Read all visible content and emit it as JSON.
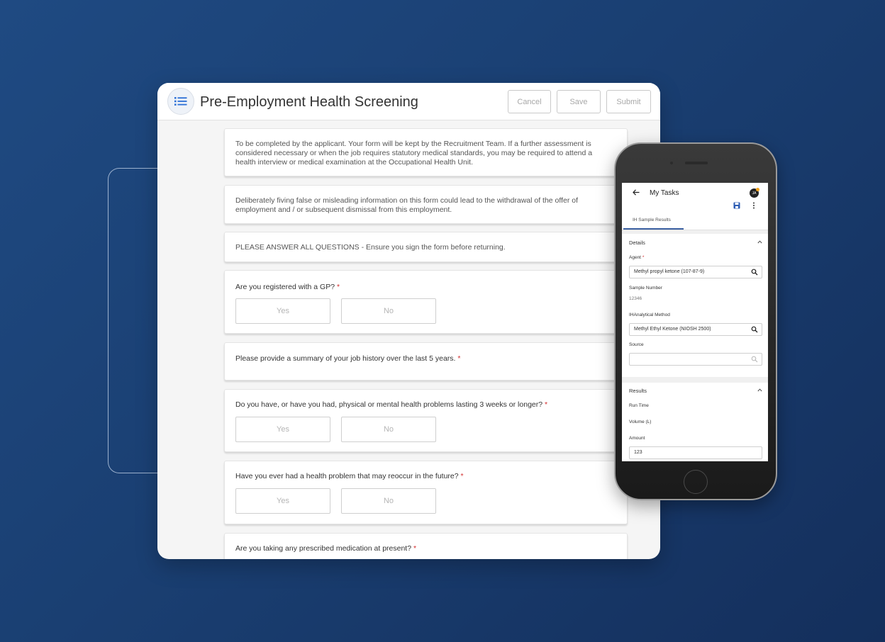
{
  "form": {
    "title": "Pre-Employment Health Screening",
    "buttons": {
      "cancel": "Cancel",
      "save": "Save",
      "submit": "Submit"
    },
    "intro": "To be completed by the applicant. Your form will be kept by the Recruitment Team. If a further assessment is considered necessary or when the job requires statutory medical standards, you may be required to attend a health interview or medical examination at the Occupational Health Unit.",
    "warning": "Deliberately fiving false or misleading information on this form could lead to the withdrawal of the offer of employment and / or subsequent dismissal from this employment.",
    "notice": "PLEASE ANSWER ALL QUESTIONS - Ensure you sign the form before returning.",
    "required_marker": "*",
    "yes_label": "Yes",
    "no_label": "No",
    "questions": [
      "Are you registered with a GP?",
      "Please provide a summary of your job history over the last 5 years.",
      "Do you have, or have you had, physical or mental health problems lasting 3 weeks or longer?",
      "Have you ever had a health problem that may reoccur in the future?",
      "Are you taking any prescribed medication at present?"
    ]
  },
  "phone": {
    "title": "My Tasks",
    "avatar_initials": "JA",
    "tab": "IH Sample Results",
    "details": {
      "title": "Details",
      "agent_label": "Agent",
      "agent_value": "Methyl propyl ketone (107-87-9)",
      "sample_number_label": "Sample Number",
      "sample_number_value": "12346",
      "method_label": "IHAnalytical Method",
      "method_value": "Methyl Ethyl Ketone (NIOSH 2500)",
      "source_label": "Source",
      "source_value": ""
    },
    "results": {
      "title": "Results",
      "run_time_label": "Run Time",
      "volume_label": "Volume (L)",
      "amount_label": "Amount",
      "amount_value": "123"
    }
  }
}
